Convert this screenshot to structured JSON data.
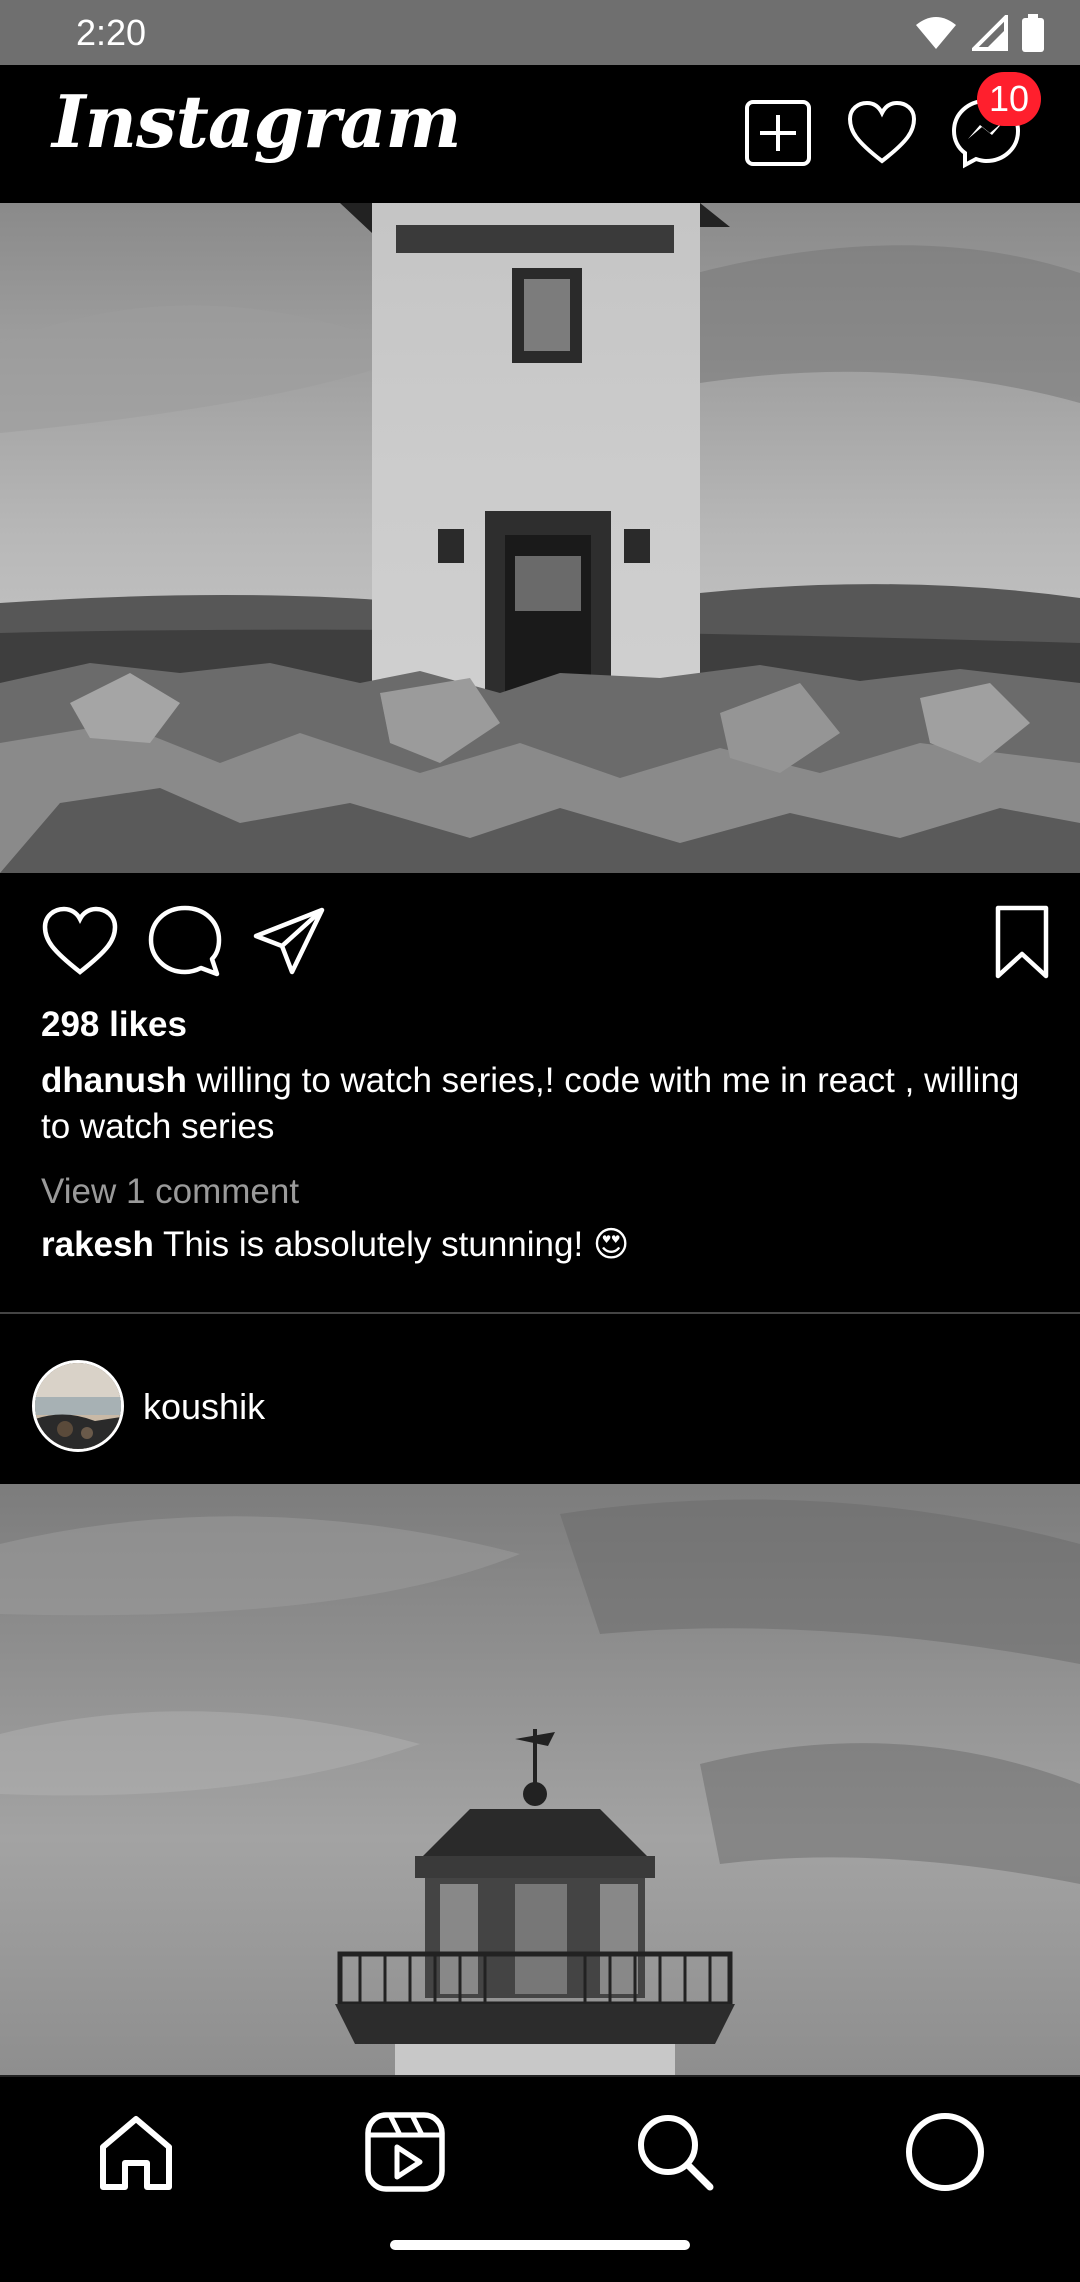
{
  "status": {
    "time": "2:20"
  },
  "app": {
    "title": "Instagram"
  },
  "header": {
    "notification_count": "10"
  },
  "post1": {
    "likes": "298 likes",
    "author": "dhanush",
    "caption": "willing to watch series,! code with me in react , willing to watch series",
    "view_comments": "View 1 comment",
    "comment_author": "rakesh",
    "comment_text": "This is absolutely stunning! 😍"
  },
  "post2": {
    "username": "koushik"
  },
  "colors": {
    "badge": "#ff1f2d",
    "background": "#000000",
    "muted_text": "#9a9a9a"
  },
  "icons": {
    "header": [
      "add-post-icon",
      "heart-icon",
      "messenger-icon"
    ],
    "post_actions": [
      "like-icon",
      "comment-icon",
      "share-icon",
      "bookmark-icon"
    ],
    "bottom_nav": [
      "home-icon",
      "reels-icon",
      "search-icon",
      "profile-icon"
    ]
  }
}
